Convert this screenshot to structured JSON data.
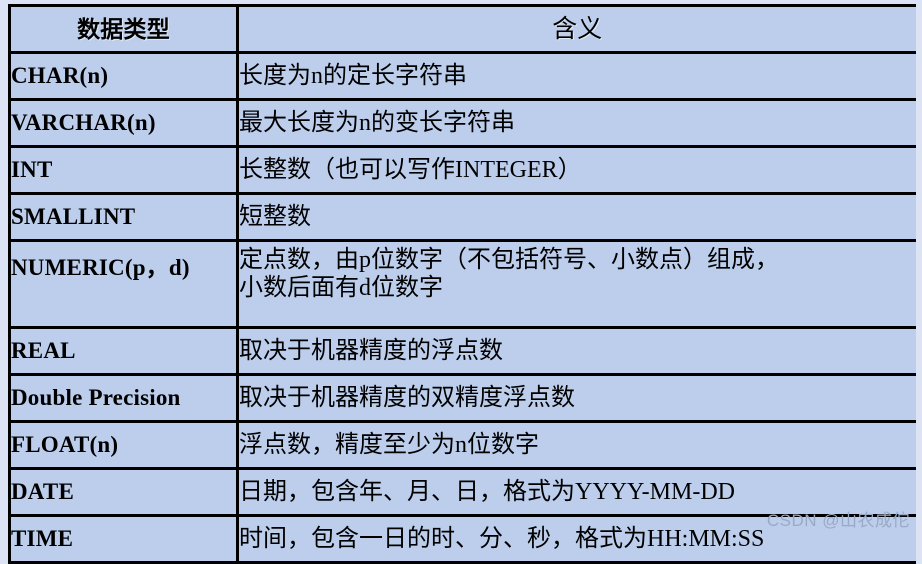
{
  "table": {
    "headers": [
      "数据类型",
      "含义"
    ],
    "rows": [
      {
        "type": "CHAR(n)",
        "meaning": [
          "长度为n的定长字符串"
        ]
      },
      {
        "type": "VARCHAR(n)",
        "meaning": [
          "最大长度为n的变长字符串"
        ]
      },
      {
        "type": "INT",
        "meaning": [
          "长整数（也可以写作INTEGER）"
        ]
      },
      {
        "type": "SMALLINT",
        "meaning": [
          "短整数"
        ]
      },
      {
        "type": "NUMERIC(p，d)",
        "meaning": [
          "定点数，由p位数字（不包括符号、小数点）组成，",
          "小数后面有d位数字"
        ]
      },
      {
        "type": "REAL",
        "meaning": [
          "取决于机器精度的浮点数"
        ]
      },
      {
        "type": "Double Precision",
        "meaning": [
          "取决于机器精度的双精度浮点数"
        ]
      },
      {
        "type": "FLOAT(n)",
        "meaning": [
          "浮点数，精度至少为n位数字"
        ]
      },
      {
        "type": "DATE",
        "meaning": [
          "日期，包含年、月、日，格式为YYYY-MM-DD"
        ]
      },
      {
        "type": "TIME",
        "meaning": [
          "时间，包含一日的时、分、秒，格式为HH:MM:SS"
        ]
      }
    ]
  },
  "watermark": "CSDN @山农成佗",
  "colors": {
    "cell_background": "#bcceec",
    "page_background": "#dce3f5",
    "border": "#000000",
    "watermark_text": "#9aa9c6"
  }
}
